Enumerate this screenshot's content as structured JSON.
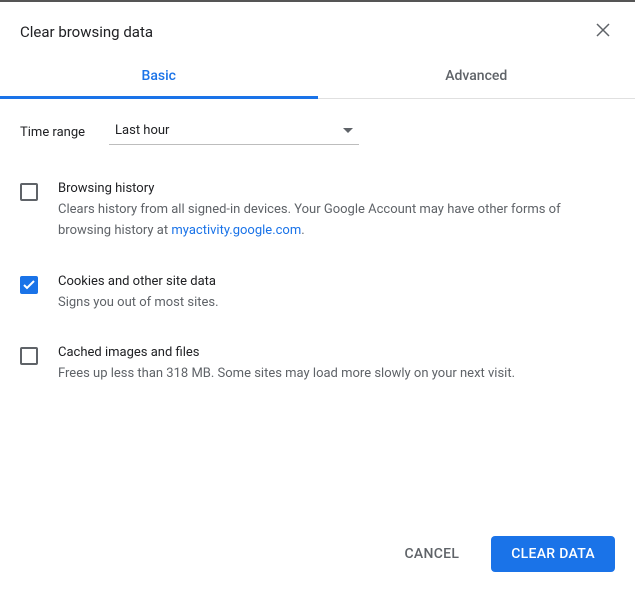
{
  "dialog": {
    "title": "Clear browsing data"
  },
  "tabs": {
    "basic": "Basic",
    "advanced": "Advanced"
  },
  "timeRange": {
    "label": "Time range",
    "selected": "Last hour"
  },
  "options": {
    "browsingHistory": {
      "title": "Browsing history",
      "descPrefix": "Clears history from all signed-in devices. Your Google Account may have other forms of browsing history at ",
      "link": "myactivity.google.com",
      "descSuffix": ".",
      "checked": false
    },
    "cookies": {
      "title": "Cookies and other site data",
      "desc": "Signs you out of most sites.",
      "checked": true
    },
    "cached": {
      "title": "Cached images and files",
      "desc": "Frees up less than 318 MB. Some sites may load more slowly on your next visit.",
      "checked": false
    }
  },
  "footer": {
    "cancel": "CANCEL",
    "clear": "CLEAR DATA"
  }
}
